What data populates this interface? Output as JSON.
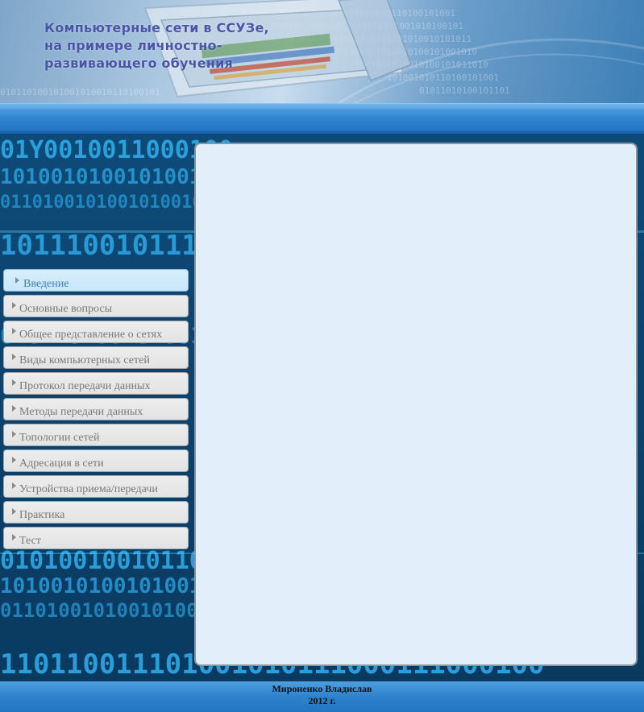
{
  "header": {
    "title_lines": [
      "Компьютерные сети в ССУЗе,",
      "на примере личностно-",
      "развивающего обучения"
    ]
  },
  "menu": {
    "items": [
      {
        "label": "Введение",
        "active": true,
        "icon": "arrow-right-icon"
      },
      {
        "label": "Основные вопросы",
        "icon": "arrow-right-icon"
      },
      {
        "label": "Общее представление о сетях",
        "icon": "arrow-right-icon"
      },
      {
        "label": "Виды компьютерных сетей",
        "icon": "arrow-right-icon"
      },
      {
        "label": "Протокол передачи данных",
        "icon": "arrow-right-icon"
      },
      {
        "label": "Методы передачи данных",
        "icon": "arrow-right-icon"
      },
      {
        "label": "Топологии сетей",
        "icon": "arrow-right-icon"
      },
      {
        "label": "Адресация в сети",
        "icon": "arrow-right-icon"
      },
      {
        "label": "Устройства приема/передачи",
        "icon": "arrow-right-icon"
      },
      {
        "label": "Практика",
        "icon": "arrow-right-icon"
      },
      {
        "label": "Тест",
        "icon": "arrow-right-icon"
      }
    ]
  },
  "footer": {
    "author": "Мироненко Владислав",
    "year": "2012 г."
  },
  "colors": {
    "background": "#0a3f66",
    "band": "#2f86d2",
    "content_panel": "#e2eefa",
    "active_menu": "#cde9fa",
    "menu_item": "#e6e6e6"
  }
}
